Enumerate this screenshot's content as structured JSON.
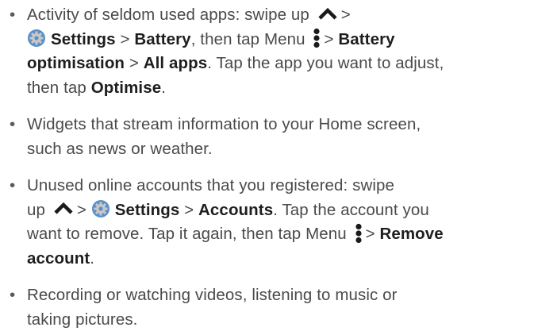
{
  "bullet": "•",
  "icons": {
    "swipe_up": "chevron-up-icon",
    "settings": "settings-gear-icon",
    "menu": "menu-more-vertical-icon"
  },
  "colors": {
    "text": "#4a4a4a",
    "bold": "#1e1e1e",
    "gear_outer": "#5b8fc7",
    "gear_inner": "#c8c8c8"
  },
  "items": [
    {
      "lines": [
        {
          "parts": [
            "Activity of seldom used apps: swipe up ",
            ">"
          ]
        },
        {
          "parts": [
            "Settings",
            " > ",
            "Battery",
            ", then tap Menu ",
            ">",
            "Battery"
          ]
        },
        {
          "parts": [
            "optimisation",
            " > ",
            "All apps",
            ". Tap the app you want to adjust,"
          ]
        },
        {
          "parts": [
            "then tap ",
            "Optimise",
            "."
          ]
        }
      ]
    },
    {
      "lines": [
        {
          "parts": [
            "Widgets that stream information to your Home screen,"
          ]
        },
        {
          "parts": [
            "such as news or weather."
          ]
        }
      ]
    },
    {
      "lines": [
        {
          "parts": [
            "Unused online accounts that you registered: swipe"
          ]
        },
        {
          "parts": [
            "up ",
            ">",
            "Settings",
            " > ",
            "Accounts",
            ". Tap the account you"
          ]
        },
        {
          "parts": [
            "want to remove. Tap it again, then tap Menu ",
            ">",
            "Remove"
          ]
        },
        {
          "parts": [
            "account",
            "."
          ]
        }
      ]
    },
    {
      "lines": [
        {
          "parts": [
            "Recording or watching videos, listening to music or"
          ]
        },
        {
          "parts": [
            "taking pictures."
          ]
        }
      ]
    }
  ]
}
